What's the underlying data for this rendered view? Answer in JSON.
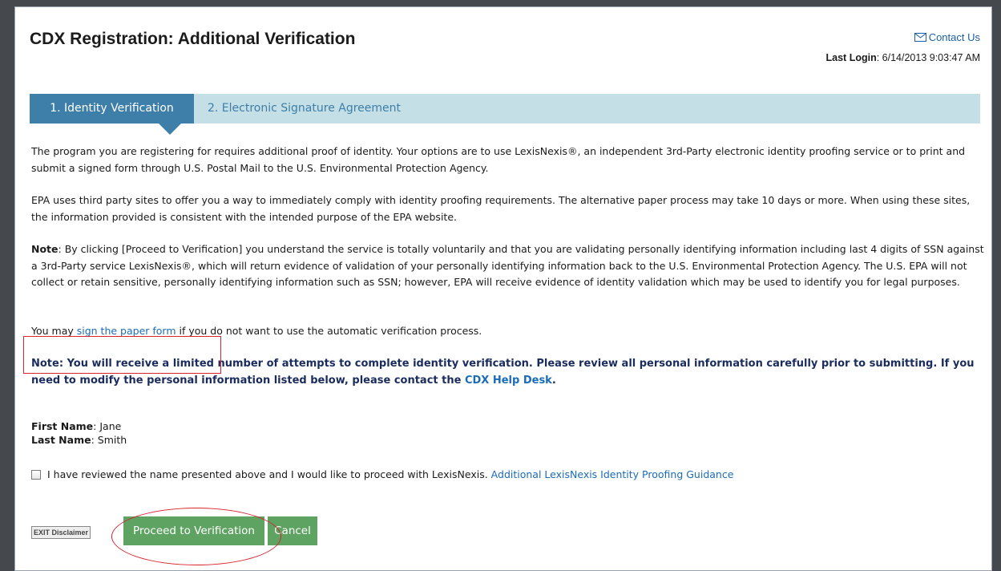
{
  "header": {
    "title": "CDX Registration: Additional Verification",
    "contact_label": "Contact Us",
    "last_login_label": "Last Login",
    "last_login_value": ": 6/14/2013 9:03:47 AM"
  },
  "tabs": [
    {
      "label": "1. Identity Verification",
      "active": true
    },
    {
      "label": "2. Electronic Signature Agreement",
      "active": false
    }
  ],
  "content": {
    "intro": "The program you are registering for requires additional proof of identity. Your options are to use LexisNexis®, an independent 3rd-Party electronic identity proofing service or to print and submit a signed form through U.S. Postal Mail to the U.S. Environmental Protection Agency.",
    "third_party": "EPA uses third party sites to offer you a way to immediately comply with identity proofing requirements. The alternative paper process may take 10 days or more. When using these sites, the information provided is consistent with the intended purpose of the EPA website.",
    "note_label": "Note",
    "note_text": ": By clicking [Proceed to Verification] you understand the service is totally voluntarily and that you are validating personally identifying information including last 4 digits of SSN against a 3rd-Party service LexisNexis®, which will return evidence of validation of your personally identifying information back to the U.S. Environmental Protection Agency. The U.S. EPA will not collect or retain sensitive, personally identifying information such as SSN; however, EPA will receive evidence of identity validation which may be used to identify you for legal purposes.",
    "paper_prefix": "You may ",
    "paper_link": "sign the paper form",
    "paper_suffix": " if you do not want to use the automatic verification process.",
    "warning_text": "Note: You will receive a limited number of attempts to complete identity verification. Please review all personal information carefully prior to submitting. If you need to modify the personal information listed below, please contact the ",
    "helpdesk_link": "CDX Help Desk",
    "warning_end": ".",
    "first_name_label": "First Name",
    "first_name_value": ": Jane",
    "last_name_label": "Last Name",
    "last_name_value": ": Smith",
    "checkbox_label": "I have reviewed the name presented above and I would like to proceed with LexisNexis. ",
    "guidance_link": "Additional LexisNexis Identity Proofing Guidance"
  },
  "footer": {
    "exit_disclaimer": "EXIT Disclaimer",
    "proceed_label": "Proceed to Verification",
    "cancel_label": "Cancel"
  },
  "colors": {
    "tab_active": "#3d7fa8",
    "tab_bar": "#c5dfe7",
    "button_green": "#5fa363",
    "link": "#1a6cb8",
    "annotation_red": "#d9232d"
  }
}
